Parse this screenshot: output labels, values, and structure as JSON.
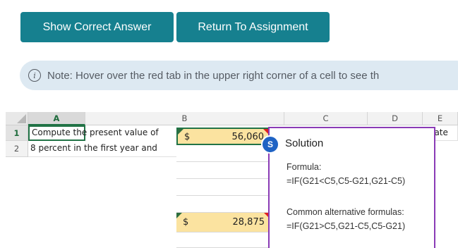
{
  "buttons": {
    "show_answer": "Show Correct Answer",
    "return": "Return To Assignment"
  },
  "note": {
    "icon": "info-icon",
    "icon_glyph": "i",
    "text": "Note: Hover over the red tab in the upper right corner of a cell to see th"
  },
  "sheet": {
    "columns": [
      "A",
      "B",
      "C",
      "D",
      "E"
    ],
    "rows": [
      "1",
      "2"
    ],
    "row1": {
      "a": "Compute the present value of",
      "e": "t rate"
    },
    "row2": {
      "a": "8 percent in the first year and"
    },
    "b_inputs": [
      {
        "currency": "$",
        "value": "56,060"
      },
      {
        "currency": "$",
        "value": "28,875"
      }
    ]
  },
  "solution": {
    "badge": "S",
    "title": "Solution",
    "formula_label": "Formula:",
    "formula": "=IF(G21<C5,C5-G21,G21-C5)",
    "alt_label": "Common alternative formulas:",
    "alt_formula": "=IF(G21>C5,G21-C5,C5-G21)"
  },
  "colors": {
    "button": "#16808f",
    "note_bg": "#dde9f2",
    "popup_border": "#8a3bb6",
    "badge": "#1f63c4",
    "input_fill": "#fbe3a0",
    "excel_green": "#217346"
  }
}
